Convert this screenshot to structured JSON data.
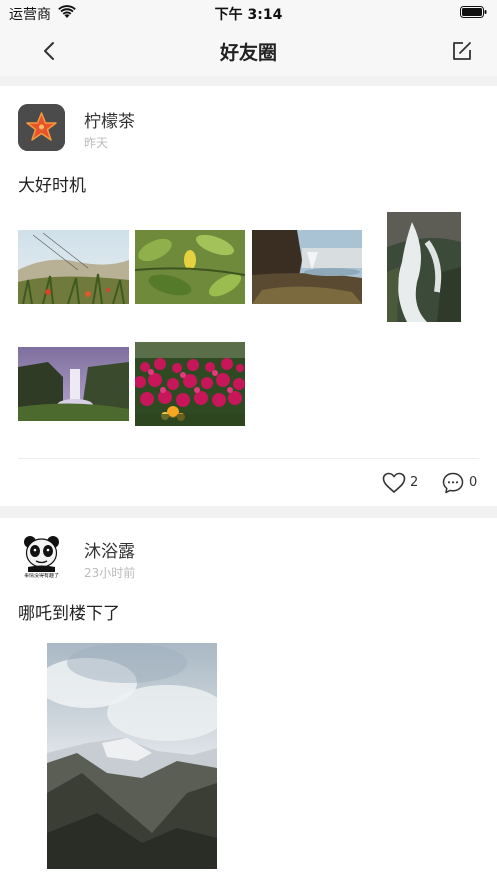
{
  "status_bar": {
    "carrier": "运营商",
    "time": "下午 3:14"
  },
  "nav": {
    "title": "好友圈",
    "back_icon": "chevron-left-icon",
    "edit_icon": "compose-icon"
  },
  "posts": [
    {
      "username": "柠檬茶",
      "time": "昨天",
      "text": "大好时机",
      "avatar_icon": "starfish-avatar",
      "images": [
        "grassland-dune",
        "green-leaves-lemon",
        "waterfall-coast",
        "waterfall-rocks",
        "skogafoss-waterfall",
        "pink-flower-field"
      ],
      "likes": "2",
      "comments": "0"
    },
    {
      "username": "沐浴露",
      "time": "23小时前",
      "text": "哪吒到楼下了",
      "avatar_icon": "panda-meme-avatar",
      "avatar_caption": "事情没得有趣了",
      "images": [
        "misty-mountains"
      ]
    }
  ]
}
